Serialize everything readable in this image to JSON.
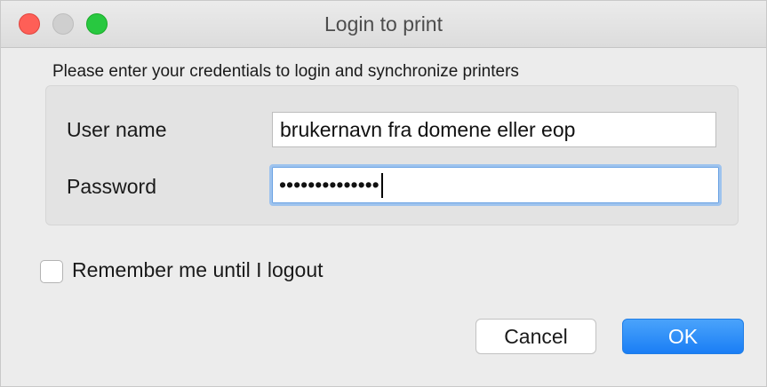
{
  "window": {
    "title": "Login to print"
  },
  "prompt": "Please enter your credentials to login and synchronize printers",
  "form": {
    "username_label": "User name",
    "username_value": "brukernavn fra domene eller eop",
    "password_label": "Password",
    "password_masked": "••••••••••••••"
  },
  "remember": {
    "label": "Remember me until I logout",
    "checked": false
  },
  "buttons": {
    "cancel": "Cancel",
    "ok": "OK"
  },
  "colors": {
    "close": "#fe5f57",
    "minimize_disabled": "#cfcfcf",
    "zoom": "#28c840",
    "ok_button": "#1a7ef5",
    "focus_ring": "#9ec3ee"
  }
}
